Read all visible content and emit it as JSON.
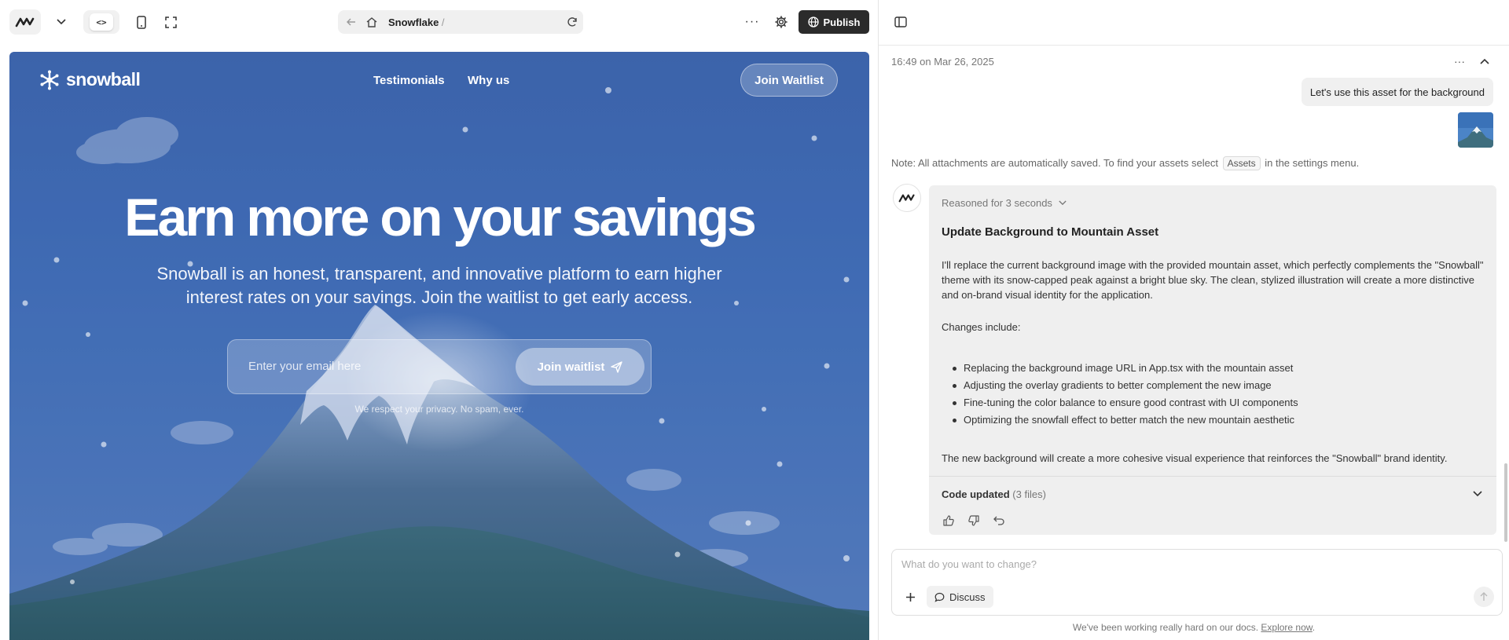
{
  "toolbar": {
    "code_glyph": "<>",
    "url": {
      "text": "Snowflake",
      "slash": "/"
    },
    "more_glyph": "···",
    "publish_label": "Publish",
    "icons": [
      "app-logo-icon",
      "chevron-down-icon",
      "code-icon",
      "mobile-icon",
      "fullscreen-icon",
      "arrow-left-icon",
      "home-icon",
      "refresh-icon",
      "more-icon",
      "gear-icon",
      "globe-icon"
    ]
  },
  "preview": {
    "brand": "snowball",
    "nav": {
      "testimonials": "Testimonials",
      "why_us": "Why us"
    },
    "join_button": "Join Waitlist",
    "hero_title": "Earn more on your savings",
    "hero_subtitle": "Snowball is an honest, transparent, and innovative platform to earn higher interest rates on your savings. Join the waitlist to get early access.",
    "email_placeholder": "Enter your email here",
    "submit_label": "Join waitlist",
    "privacy": "We respect your privacy. No spam, ever."
  },
  "chat": {
    "timestamp": "16:49 on Mar 26, 2025",
    "user_message": "Let's use this asset for the background",
    "note": {
      "before": "Note: All attachments are automatically saved. To find your assets select",
      "chip": "Assets",
      "after": "in the settings menu."
    },
    "reasoned": "Reasoned for 3 seconds",
    "title": "Update Background to Mountain Asset",
    "paragraph": "I'll replace the current background image with the provided mountain asset, which perfectly complements the \"Snowball\" theme with its snow-capped peak against a bright blue sky. The clean, stylized illustration will create a more distinctive and on-brand visual identity for the application.",
    "changes_label": "Changes include:",
    "changes": [
      "Replacing the background image URL in App.tsx with the mountain asset",
      "Adjusting the overlay gradients to better complement the new image",
      "Fine-tuning the color balance to ensure good contrast with UI components",
      "Optimizing the snowfall effect to better match the new mountain aesthetic"
    ],
    "closing": "The new background will create a more cohesive visual experience that reinforces the \"Snowball\" brand identity.",
    "code_updated": {
      "label": "Code updated",
      "count": "(3 files)"
    },
    "input_placeholder": "What do you want to change?",
    "discuss_label": "Discuss",
    "footer": {
      "text": "We've been working really hard on our docs.",
      "link": "Explore now",
      "end": "."
    }
  },
  "colors": {
    "publish_bg": "#2b2b2b",
    "preview_blue": "#3f6bb3",
    "bubble_bg": "#f0f0f0",
    "card_bg": "#efefef"
  }
}
